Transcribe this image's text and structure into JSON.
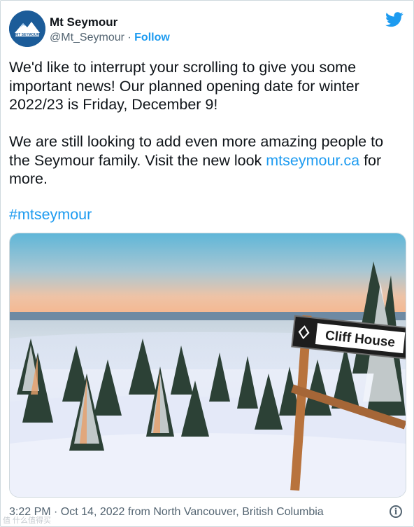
{
  "author": {
    "display_name": "Mt Seymour",
    "handle": "@Mt_Seymour",
    "separator": " · ",
    "follow_label": "Follow",
    "avatar_text": "MT SEYMOUR",
    "avatar_icon": "mountain-logo-icon"
  },
  "tweet": {
    "paragraph1": "We'd like to interrupt your scrolling to give you some important news! Our planned opening date for winter 2022/23 is Friday, December 9!",
    "paragraph2_before": "We are still looking to add even more amazing people to the Seymour family. Visit the new look ",
    "link_text": "mtseymour.ca",
    "paragraph2_after": " for more.",
    "hashtag": "#mtseymour"
  },
  "media": {
    "sign_text": "Cliff House",
    "sign_icon": "black-diamond-icon"
  },
  "footer": {
    "timestamp": "3:22 PM · Oct 14, 2022 from North Vancouver, British Columbia",
    "info_glyph": "i"
  },
  "watermark": "值 什么值得买",
  "colors": {
    "accent": "#1d9bf0",
    "text": "#0f1419",
    "muted": "#536471"
  }
}
